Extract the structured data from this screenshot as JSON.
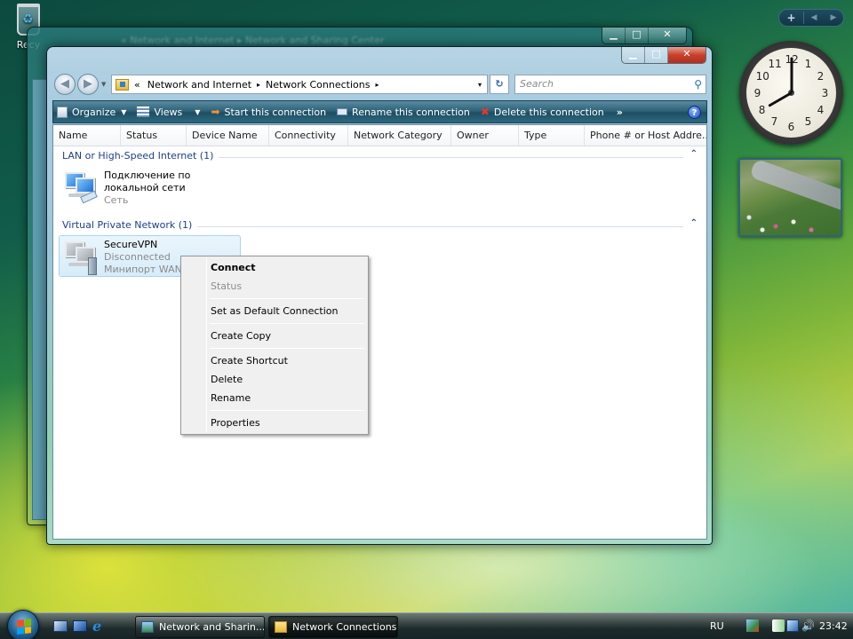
{
  "desktop": {
    "recycle_bin_label": "Recy"
  },
  "background_window": {
    "breadcrumb": "« Network and Internet ▸ Network and Sharing Center"
  },
  "window": {
    "controls": {
      "minimize": "▁",
      "maximize": "□",
      "close": "✕"
    },
    "nav": {
      "back": "◀",
      "forward": "▶"
    },
    "address": {
      "prefix": "«",
      "crumbs": [
        "Network and Internet",
        "Network Connections"
      ],
      "separator": "▸",
      "dropdown": "▾"
    },
    "refresh_icon": "↻",
    "search": {
      "placeholder": "Search",
      "icon": "⚲"
    },
    "toolbar": {
      "organize": "Organize",
      "views": "Views",
      "start": "Start this connection",
      "rename": "Rename this connection",
      "delete": "Delete this connection",
      "more": "»",
      "help": "?"
    },
    "columns": [
      "Name",
      "Status",
      "Device Name",
      "Connectivity",
      "Network Category",
      "Owner",
      "Type",
      "Phone # or Host Addre..."
    ],
    "groups": [
      {
        "title": "LAN or High-Speed Internet (1)",
        "items": [
          {
            "name": "Подключение по локальной сети",
            "status": "Сеть",
            "device": ""
          }
        ]
      },
      {
        "title": "Virtual Private Network (1)",
        "items": [
          {
            "name": "SecureVPN",
            "status": "Disconnected",
            "device": "Минипорт WAN"
          }
        ]
      }
    ]
  },
  "context_menu": {
    "items": [
      {
        "label": "Connect",
        "bold": true
      },
      {
        "label": "Status",
        "disabled": true
      },
      {
        "label": "Set as Default Connection"
      },
      {
        "label": "Create Copy"
      },
      {
        "label": "Create Shortcut"
      },
      {
        "label": "Delete"
      },
      {
        "label": "Rename"
      },
      {
        "label": "Properties"
      }
    ]
  },
  "gadgets": {
    "controls": {
      "add": "+",
      "prev": "◀",
      "next": "▶"
    },
    "clock": {
      "hour": 8,
      "minute": 0,
      "numbers": [
        "12",
        "1",
        "2",
        "3",
        "4",
        "5",
        "6",
        "7",
        "8",
        "9",
        "10",
        "11"
      ]
    }
  },
  "taskbar": {
    "tasks": [
      "Network and Sharin...",
      "Network Connections"
    ],
    "active_task": 1,
    "language": "RU",
    "time": "23:42"
  }
}
